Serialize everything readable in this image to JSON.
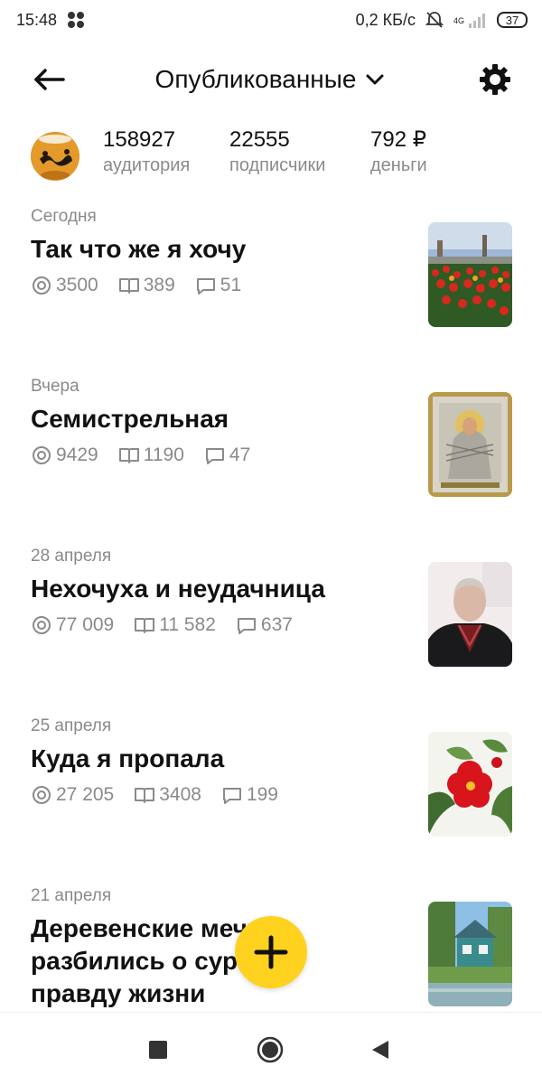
{
  "status_bar": {
    "time": "15:48",
    "network_speed": "0,2 КБ/с",
    "network_type": "4G",
    "battery": "37"
  },
  "header": {
    "title": "Опубликованные",
    "back_icon": "arrow-left-icon",
    "dropdown_icon": "chevron-down-icon",
    "settings_icon": "gear-icon"
  },
  "stats": [
    {
      "value": "158927",
      "label": "аудитория"
    },
    {
      "value": "22555",
      "label": "подписчики"
    },
    {
      "value": "792 ₽",
      "label": "деньги"
    }
  ],
  "articles": [
    {
      "date": "Сегодня",
      "title": "Так что же я хочу",
      "views": "3500",
      "reads": "389",
      "comments": "51",
      "thumbnail": "garden-flowers-image"
    },
    {
      "date": "Вчера",
      "title": "Семистрельная",
      "views": "9429",
      "reads": "1190",
      "comments": "47",
      "thumbnail": "icon-painting-image"
    },
    {
      "date": "28 апреля",
      "title": "Нехочуха и неудачница",
      "views": "77 009",
      "reads": "11 582",
      "comments": "637",
      "thumbnail": "woman-portrait-image"
    },
    {
      "date": "25 апреля",
      "title": "Куда я пропала",
      "views": "27 205",
      "reads": "3408",
      "comments": "199",
      "thumbnail": "red-flower-image"
    },
    {
      "date": "21 апреля",
      "title": "Деревенские мечты разбились о суровую правду жизни",
      "thumbnail": "village-house-image"
    }
  ],
  "fab": {
    "icon": "plus-icon"
  },
  "nav_bar": {
    "recent_icon": "square-icon",
    "home_icon": "circle-icon",
    "back_icon": "triangle-back-icon"
  },
  "colors": {
    "accent": "#ffd21f",
    "text": "#111111",
    "muted": "#8a8a8a"
  }
}
